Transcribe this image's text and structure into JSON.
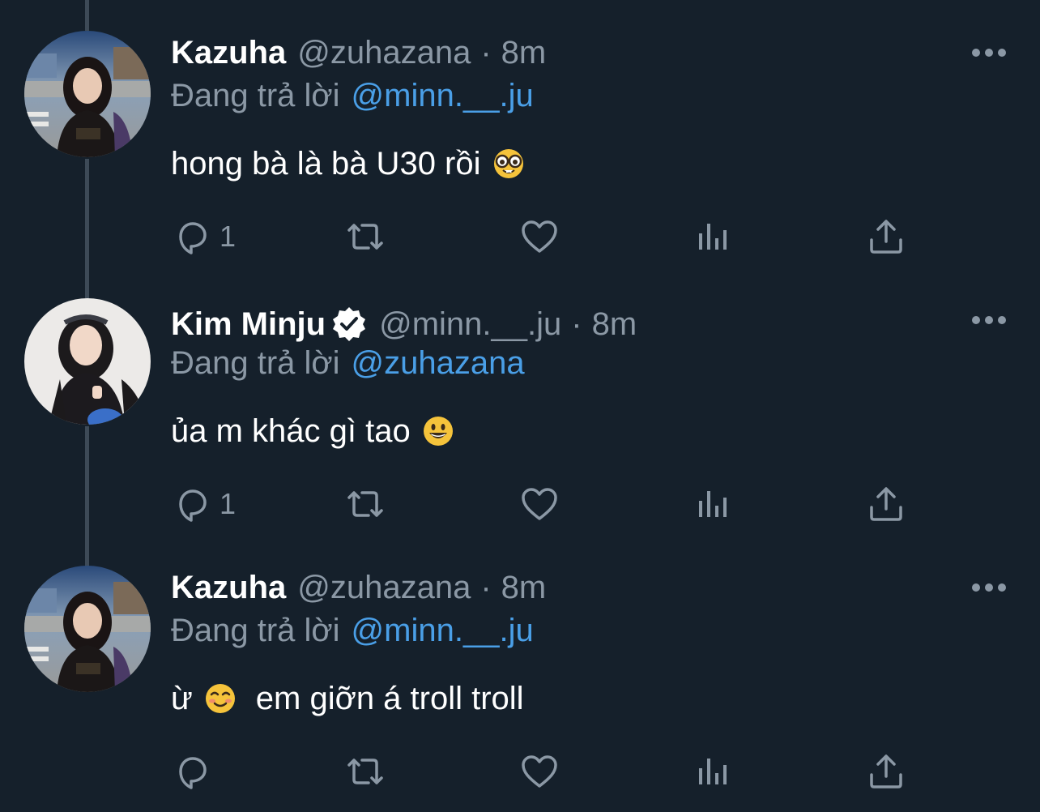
{
  "tweets": [
    {
      "name": "Kazuha",
      "handle": "@zuhazana",
      "separator": "·",
      "time": "8m",
      "reply_prefix": "Đang trả lời",
      "reply_to": "@minn.__.ju",
      "text": "hong bà là bà U30 rồi",
      "emoji_icon": "nerd-face-emoji-icon",
      "reply_count": "1",
      "verified": false
    },
    {
      "name": "Kim Minju",
      "handle": "@minn.__.ju",
      "separator": "·",
      "time": "8m",
      "reply_prefix": "Đang trả lời",
      "reply_to": "@zuhazana",
      "text": "ủa m khác gì tao",
      "emoji_icon": "grinning-face-emoji-icon",
      "reply_count": "1",
      "verified": true
    },
    {
      "name": "Kazuha",
      "handle": "@zuhazana",
      "separator": "·",
      "time": "8m",
      "reply_prefix": "Đang trả lời",
      "reply_to": "@minn.__.ju",
      "text_before_emoji": "ừ",
      "text_after_emoji": "em giỡn á troll troll",
      "emoji_icon": "smiling-face-emoji-icon",
      "reply_count": "",
      "verified": false
    }
  ],
  "action_icons": [
    "reply-icon",
    "retweet-icon",
    "like-icon",
    "views-icon",
    "share-icon"
  ],
  "colors": {
    "background": "#15202b",
    "name": "#ffffff",
    "secondary": "#8b98a5",
    "link": "#4a9fe7",
    "thread_line": "#3d4a57"
  }
}
